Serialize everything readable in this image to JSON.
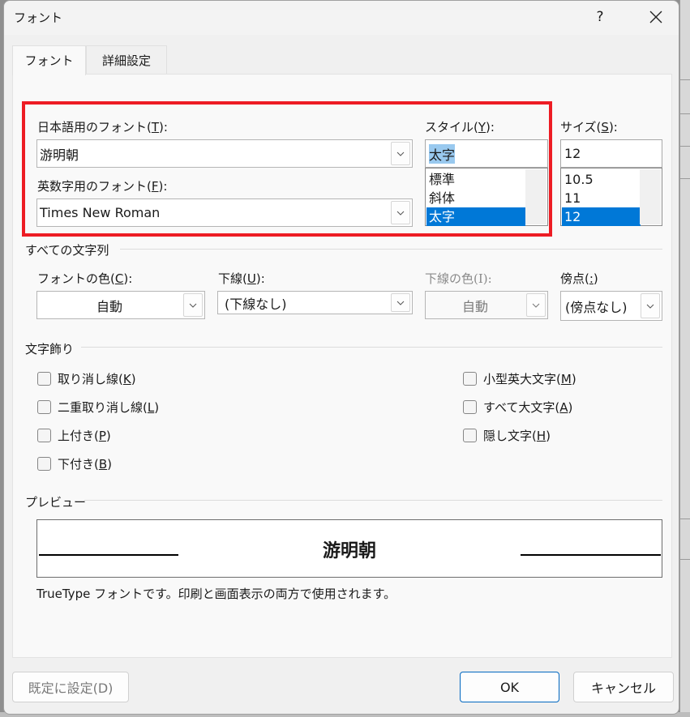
{
  "dialog": {
    "title": "フォント",
    "help_label": "?",
    "close_icon": "close-icon"
  },
  "tabs": [
    {
      "label": "フォント",
      "active": true
    },
    {
      "label": "詳細設定",
      "active": false
    }
  ],
  "japanese_font": {
    "label_prefix": "日本語用のフォント(",
    "label_key": "T",
    "label_suffix": "):",
    "value": "游明朝"
  },
  "latin_font": {
    "label_prefix": "英数字用のフォント(",
    "label_key": "F",
    "label_suffix": "):",
    "value": "Times New Roman"
  },
  "style": {
    "label_prefix": "スタイル(",
    "label_key": "Y",
    "label_suffix": "):",
    "value": "太字",
    "options": [
      "標準",
      "斜体",
      "太字"
    ],
    "selected_index": 2
  },
  "size": {
    "label_prefix": "サイズ(",
    "label_key": "S",
    "label_suffix": "):",
    "value": "12",
    "options": [
      "10.5",
      "11",
      "12"
    ],
    "selected_index": 2
  },
  "all_text_group": {
    "title": "すべての文字列",
    "font_color": {
      "label_prefix": "フォントの色(",
      "label_key": "C",
      "label_suffix": "):",
      "value": "自動"
    },
    "underline": {
      "label_prefix": "下線(",
      "label_key": "U",
      "label_suffix": "):",
      "value": "(下線なし)"
    },
    "underline_color": {
      "label": "下線の色(I):",
      "value": "自動",
      "disabled": true
    },
    "emphasis": {
      "label_prefix": "傍点(",
      "label_key": ":",
      "label_suffix": ")",
      "value": "(傍点なし)"
    }
  },
  "effects_group": {
    "title": "文字飾り",
    "left": [
      {
        "text": "取り消し線(",
        "key": "K",
        "end": ")",
        "checked": false
      },
      {
        "text": "二重取り消し線(",
        "key": "L",
        "end": ")",
        "checked": false
      },
      {
        "text": "上付き(",
        "key": "P",
        "end": ")",
        "checked": false
      },
      {
        "text": "下付き(",
        "key": "B",
        "end": ")",
        "checked": false
      }
    ],
    "right": [
      {
        "text": "小型英大文字(",
        "key": "M",
        "end": ")",
        "checked": false
      },
      {
        "text": "すべて大文字(",
        "key": "A",
        "end": ")",
        "checked": false
      },
      {
        "text": "隠し文字(",
        "key": "H",
        "end": ")",
        "checked": false
      }
    ]
  },
  "preview_group": {
    "title": "プレビュー",
    "sample_text": "游明朝",
    "description": "TrueType フォントです。印刷と画面表示の両方で使用されます。"
  },
  "buttons": {
    "set_default": "既定に設定(D)",
    "ok": "OK",
    "cancel": "キャンセル"
  },
  "colors": {
    "highlight_box": "#ed1c24",
    "selection": "#0078d7",
    "primary_border": "#0067c0"
  }
}
